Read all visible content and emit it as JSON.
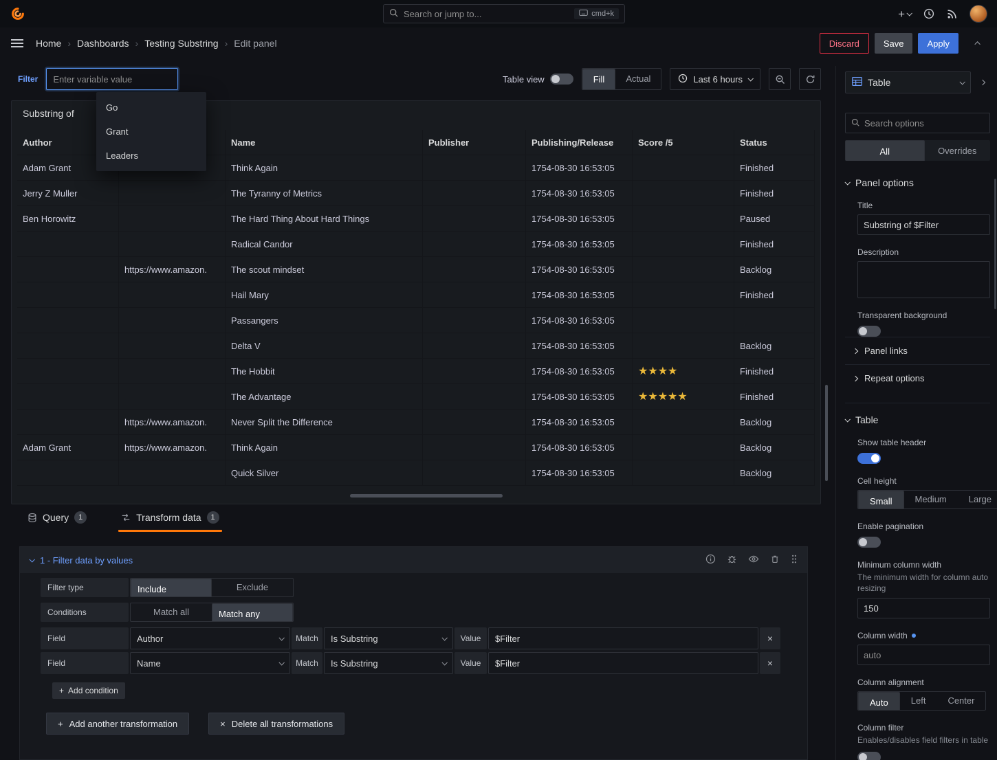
{
  "colors": {
    "accent_orange": "#ff780a",
    "accent_blue": "#3d71d9",
    "star_gold": "#eab839",
    "danger_red": "#e02f44"
  },
  "icons": {
    "star": "★",
    "close": "×",
    "plus": "+",
    "breadcrumb_sep": "›"
  },
  "topnav": {
    "search_placeholder": "Search or jump to...",
    "shortcut": "cmd+k"
  },
  "breadcrumb": {
    "items": [
      "Home",
      "Dashboards",
      "Testing Substring",
      "Edit panel"
    ]
  },
  "actions": {
    "discard": "Discard",
    "save": "Save",
    "apply": "Apply"
  },
  "toolbar": {
    "filter_label": "Filter",
    "filter_placeholder": "Enter variable value",
    "dropdown_options": [
      "Go",
      "Grant",
      "Leaders"
    ],
    "table_view_label": "Table view",
    "fill": "Fill",
    "actual": "Actual",
    "time_range": "Last 6 hours"
  },
  "panel": {
    "title": "Substring of",
    "table": {
      "headers": [
        "Author",
        "",
        "Name",
        "Publisher",
        "Publishing/Release",
        "Score /5",
        "Status"
      ],
      "rows": [
        {
          "author": "Adam Grant",
          "url": "",
          "name": "Think Again",
          "publisher": "",
          "date": "1754-08-30 16:53:05",
          "score": 0,
          "status": "Finished"
        },
        {
          "author": "Jerry Z Muller",
          "url": "",
          "name": "The Tyranny of Metrics",
          "publisher": "",
          "date": "1754-08-30 16:53:05",
          "score": 0,
          "status": "Finished"
        },
        {
          "author": "Ben Horowitz",
          "url": "",
          "name": "The Hard Thing About Hard Things",
          "publisher": "",
          "date": "1754-08-30 16:53:05",
          "score": 0,
          "status": "Paused"
        },
        {
          "author": "",
          "url": "",
          "name": "Radical Candor",
          "publisher": "",
          "date": "1754-08-30 16:53:05",
          "score": 0,
          "status": "Finished"
        },
        {
          "author": "",
          "url": "https://www.amazon.",
          "name": "The scout mindset",
          "publisher": "",
          "date": "1754-08-30 16:53:05",
          "score": 0,
          "status": "Backlog"
        },
        {
          "author": "",
          "url": "",
          "name": "Hail Mary",
          "publisher": "",
          "date": "1754-08-30 16:53:05",
          "score": 0,
          "status": "Finished"
        },
        {
          "author": "",
          "url": "",
          "name": "Passangers",
          "publisher": "",
          "date": "1754-08-30 16:53:05",
          "score": 0,
          "status": ""
        },
        {
          "author": "",
          "url": "",
          "name": "Delta V",
          "publisher": "",
          "date": "1754-08-30 16:53:05",
          "score": 0,
          "status": "Backlog"
        },
        {
          "author": "",
          "url": "",
          "name": "The Hobbit",
          "publisher": "",
          "date": "1754-08-30 16:53:05",
          "score": 4,
          "status": "Finished"
        },
        {
          "author": "",
          "url": "",
          "name": "The Advantage",
          "publisher": "",
          "date": "1754-08-30 16:53:05",
          "score": 5,
          "status": "Finished"
        },
        {
          "author": "",
          "url": "https://www.amazon.",
          "name": "Never Split the Difference",
          "publisher": "",
          "date": "1754-08-30 16:53:05",
          "score": 0,
          "status": "Backlog"
        },
        {
          "author": "Adam Grant",
          "url": "https://www.amazon.",
          "name": "Think Again",
          "publisher": "",
          "date": "1754-08-30 16:53:05",
          "score": 0,
          "status": "Backlog"
        },
        {
          "author": "",
          "url": "",
          "name": "Quick Silver",
          "publisher": "",
          "date": "1754-08-30 16:53:05",
          "score": 0,
          "status": "Backlog"
        }
      ]
    }
  },
  "bottom_tabs": {
    "query": {
      "label": "Query",
      "badge": "1"
    },
    "transform": {
      "label": "Transform data",
      "badge": "1"
    }
  },
  "transform": {
    "title": "1 - Filter data by values",
    "filter_type_label": "Filter type",
    "include": "Include",
    "exclude": "Exclude",
    "conditions_label": "Conditions",
    "match_all": "Match all",
    "match_any": "Match any",
    "field_label": "Field",
    "match_label": "Match",
    "value_label": "Value",
    "rows": [
      {
        "field": "Author",
        "match": "Is Substring",
        "value": "$Filter"
      },
      {
        "field": "Name",
        "match": "Is Substring",
        "value": "$Filter"
      }
    ],
    "add_condition": "Add condition",
    "add_transformation": "Add another transformation",
    "delete_all": "Delete all transformations"
  },
  "sidebar": {
    "viz_type": "Table",
    "search_placeholder": "Search options",
    "tabs": {
      "all": "All",
      "overrides": "Overrides"
    },
    "panel_options": {
      "section": "Panel options",
      "title_label": "Title",
      "title_value": "Substring of $Filter",
      "description_label": "Description",
      "transparent_label": "Transparent background",
      "panel_links": "Panel links",
      "repeat_options": "Repeat options"
    },
    "table_options": {
      "section": "Table",
      "show_header_label": "Show table header",
      "cell_height_label": "Cell height",
      "cell_height_options": [
        "Small",
        "Medium",
        "Large"
      ],
      "pagination_label": "Enable pagination",
      "min_col_width_label": "Minimum column width",
      "min_col_width_desc": "The minimum width for column auto resizing",
      "min_col_width_value": "150",
      "col_width_label": "Column width",
      "col_width_value": "auto",
      "col_align_label": "Column alignment",
      "col_align_options": [
        "Auto",
        "Left",
        "Center"
      ],
      "col_filter_label": "Column filter",
      "col_filter_desc": "Enables/disables field filters in table"
    }
  }
}
